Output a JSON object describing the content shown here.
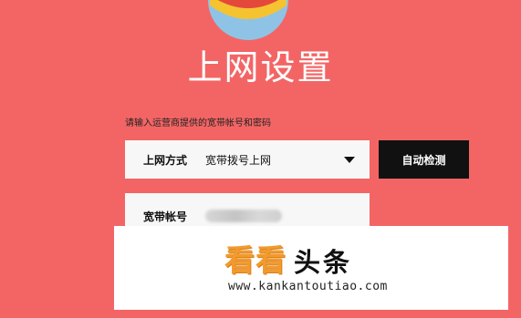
{
  "page": {
    "title": "上网设置",
    "hint": "请输入运营商提供的宽带帐号和密码"
  },
  "connection_type": {
    "label": "上网方式",
    "selected": "宽带拨号上网"
  },
  "account": {
    "label": "宽带帐号",
    "value_state": "blurred"
  },
  "detect_button": {
    "label": "自动检测"
  },
  "watermark": {
    "brand_orange": "看看",
    "brand_black": "头条",
    "url": "www.kankantoutiao.com"
  },
  "colors": {
    "background": "#f36565",
    "field_bg": "#f7f7f7",
    "button_bg": "#111111",
    "watermark_orange": "#f29a2e"
  },
  "icons": {
    "logo": "planet-logo-icon",
    "dropdown": "caret-down-icon"
  }
}
